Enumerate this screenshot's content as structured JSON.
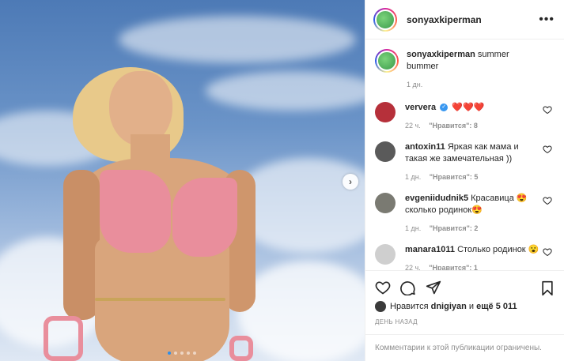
{
  "post": {
    "author": "sonyaxkiperman",
    "caption": "summer bummer",
    "caption_time": "1 дн.",
    "carousel": {
      "slides": 5,
      "active_index": 0
    }
  },
  "comments": [
    {
      "user": "ververa",
      "verified": true,
      "text": "❤️❤️❤️",
      "time": "22 ч.",
      "likes": "\"Нравится\": 8",
      "avatar_color": "#b6303a"
    },
    {
      "user": "antoxin11",
      "verified": false,
      "text": "Яркая как мама и такая же замечательная ))",
      "time": "1 дн.",
      "likes": "\"Нравится\": 5",
      "avatar_color": "#5a5a5a"
    },
    {
      "user": "evgeniidudnik5",
      "verified": false,
      "text": "Красавица 😍 сколько родинок😍",
      "time": "1 дн.",
      "likes": "\"Нравится\": 2",
      "avatar_color": "#7a7a72"
    },
    {
      "user": "manara1011",
      "verified": false,
      "text": "Столько родинок 😮",
      "time": "22 ч.",
      "likes": "\"Нравится\": 1",
      "avatar_color": "#cfcfcf"
    }
  ],
  "likes_line": {
    "prefix": "Нравится",
    "user": "dnigiyan",
    "joiner": "и",
    "others": "ещё 5 011"
  },
  "date_label": "ДЕНЬ НАЗАД",
  "comments_limited": "Комментарии к этой публикации ограничены.",
  "colors": {
    "accent": "#3897f0",
    "heart": "#ed4956",
    "muted": "#8e8e8e"
  },
  "icons": [
    "more-icon",
    "like-icon",
    "comment-icon",
    "share-icon",
    "bookmark-icon",
    "next-arrow-icon",
    "heart-small-icon",
    "verified-icon"
  ]
}
